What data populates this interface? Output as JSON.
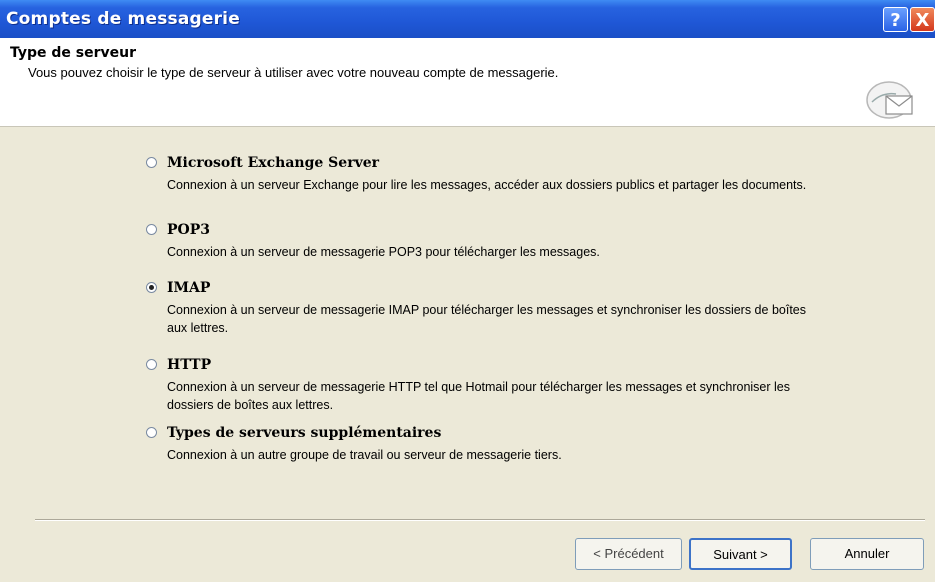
{
  "window": {
    "title": "Comptes de messagerie",
    "help_label": "?",
    "close_label": "X"
  },
  "header": {
    "title": "Type de serveur",
    "subtitle": "Vous pouvez choisir le type de serveur à utiliser avec votre nouveau compte de messagerie."
  },
  "options": [
    {
      "label": "Microsoft Exchange Server",
      "description": "Connexion à un serveur Exchange pour lire les messages, accéder aux dossiers publics et partager les documents.",
      "checked": false
    },
    {
      "label": "POP3",
      "description": "Connexion à un serveur de messagerie POP3 pour télécharger les messages.",
      "checked": false
    },
    {
      "label": "IMAP",
      "description": "Connexion à un serveur de messagerie IMAP pour télécharger les messages et synchroniser les dossiers de boîtes aux lettres.",
      "checked": true
    },
    {
      "label": "HTTP",
      "description": "Connexion à un serveur de messagerie HTTP tel que Hotmail pour télécharger les messages et synchroniser les dossiers de boîtes aux lettres.",
      "checked": false
    },
    {
      "label": "Types de serveurs supplémentaires",
      "description": "Connexion à un autre groupe de travail ou serveur de messagerie tiers.",
      "checked": false
    }
  ],
  "buttons": {
    "previous": "< Précédent",
    "next": "Suivant >",
    "cancel": "Annuler"
  }
}
